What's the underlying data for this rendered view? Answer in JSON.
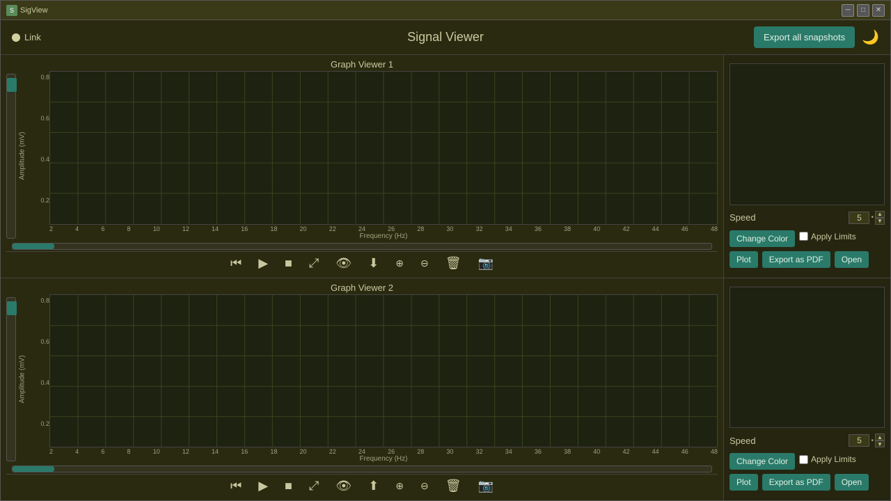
{
  "window": {
    "title": "SigView",
    "icon": "S"
  },
  "header": {
    "link_label": "Link",
    "app_title": "Signal Viewer",
    "export_btn": "Export all snapshots",
    "moon_icon": "🌙"
  },
  "graph1": {
    "title": "Graph Viewer 1",
    "y_axis_label": "Amplitude (mV)",
    "x_axis_label": "Frequency (Hz)",
    "y_ticks": [
      "0.8",
      "0.6",
      "0.4",
      "0.2"
    ],
    "x_ticks": [
      "2",
      "4",
      "6",
      "8",
      "10",
      "12",
      "14",
      "16",
      "18",
      "20",
      "22",
      "24",
      "26",
      "28",
      "30",
      "32",
      "34",
      "36",
      "38",
      "40",
      "42",
      "44",
      "46",
      "48"
    ]
  },
  "graph2": {
    "title": "Graph Viewer 2",
    "y_axis_label": "Amplitude (mV)",
    "x_axis_label": "Frequency (Hz)",
    "y_ticks": [
      "0.8",
      "0.6",
      "0.4",
      "0.2"
    ],
    "x_ticks": [
      "2",
      "4",
      "6",
      "8",
      "10",
      "12",
      "14",
      "16",
      "18",
      "20",
      "22",
      "24",
      "26",
      "28",
      "30",
      "32",
      "34",
      "36",
      "38",
      "40",
      "42",
      "44",
      "46",
      "48"
    ]
  },
  "controls": {
    "rewind": "⏮",
    "play": "▶",
    "stop": "■",
    "expand": "⤢",
    "eye": "👁",
    "download": "⬇",
    "zoom_in": "🔍+",
    "zoom_out": "🔍-",
    "delete": "🗑",
    "snapshot": "📷",
    "upload": "⬆"
  },
  "side_panel_1": {
    "speed_label": "Speed",
    "speed_value": "5",
    "change_color_btn": "Change Color",
    "apply_limits_label": "Apply Limits",
    "plot_btn": "Plot",
    "export_pdf_btn": "Export as PDF",
    "open_btn": "Open"
  },
  "side_panel_2": {
    "speed_label": "Speed",
    "speed_value": "5",
    "change_color_btn": "Change Color",
    "apply_limits_label": "Apply Limits",
    "plot_btn": "Plot",
    "export_pdf_btn": "Export as PDF",
    "open_btn": "Open"
  }
}
